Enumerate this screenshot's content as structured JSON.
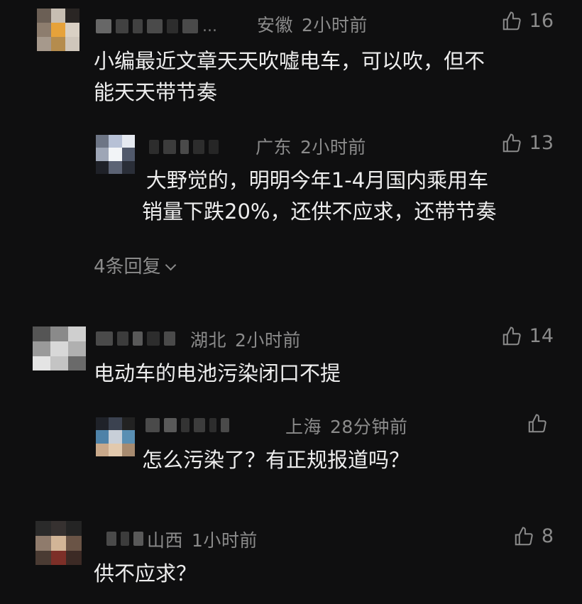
{
  "comments": [
    {
      "location": "安徽",
      "time": "2小时前",
      "likes": "16",
      "ellipsis": "...",
      "text_lines": [
        "小编最近文章天天吹嘘电车，可以吹，但不",
        "能天天带节奏"
      ],
      "reply": {
        "location": "广东",
        "time": "2小时前",
        "likes": "13",
        "text_lines": [
          " 大野觉的，明明今年1-4月国内乘用车",
          "销量下跌20%，还供不应求，还带节奏"
        ]
      },
      "more_replies": "4条回复"
    },
    {
      "location": "湖北",
      "time": "2小时前",
      "likes": "14",
      "text_lines": [
        "电动车的电池污染闭口不提"
      ],
      "reply": {
        "location": "上海",
        "time": "28分钟前",
        "likes": "",
        "text_lines": [
          "怎么污染了？有正规报道吗？"
        ]
      }
    },
    {
      "location": "山西",
      "time": "1小时前",
      "likes": "8",
      "text_lines": [
        "供不应求？"
      ]
    }
  ]
}
